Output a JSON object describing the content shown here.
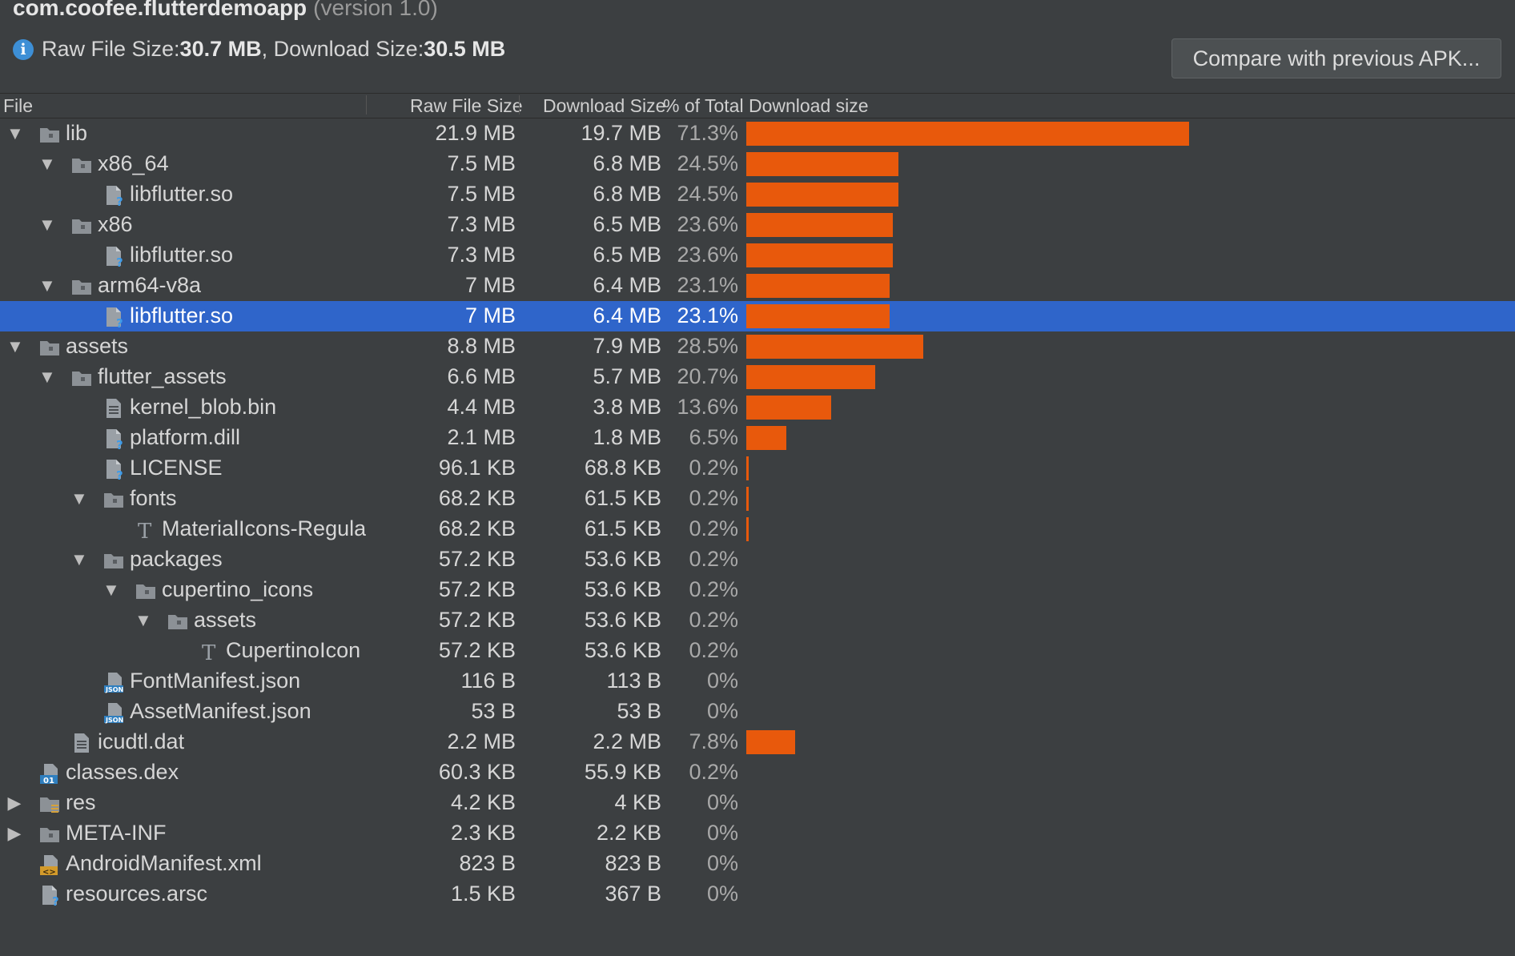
{
  "header": {
    "package": "com.coofee.flutterdemoapp",
    "version": "(version 1.0)"
  },
  "info": {
    "raw_label": "Raw File Size: ",
    "raw_value": "30.7 MB",
    "sep": ", Download Size: ",
    "dl_value": "30.5 MB"
  },
  "compare_button": "Compare with previous APK...",
  "columns": {
    "file": "File",
    "raw": "Raw File Size",
    "download": "Download Size",
    "percent": "% of Total Download size"
  },
  "accent": "#e8590c",
  "selection_color": "#2f65ca",
  "rows": [
    {
      "name": "lib",
      "raw": "21.9 MB",
      "dl": "19.7 MB",
      "pct": "71.3%",
      "level": 0,
      "kind": "folder",
      "expand": "open",
      "frac": 0.713
    },
    {
      "name": "x86_64",
      "raw": "7.5 MB",
      "dl": "6.8 MB",
      "pct": "24.5%",
      "level": 1,
      "kind": "folder",
      "expand": "open",
      "frac": 0.245
    },
    {
      "name": "libflutter.so",
      "raw": "7.5 MB",
      "dl": "6.8 MB",
      "pct": "24.5%",
      "level": 2,
      "kind": "unknown",
      "expand": "none",
      "frac": 0.245
    },
    {
      "name": "x86",
      "raw": "7.3 MB",
      "dl": "6.5 MB",
      "pct": "23.6%",
      "level": 1,
      "kind": "folder",
      "expand": "open",
      "frac": 0.236
    },
    {
      "name": "libflutter.so",
      "raw": "7.3 MB",
      "dl": "6.5 MB",
      "pct": "23.6%",
      "level": 2,
      "kind": "unknown",
      "expand": "none",
      "frac": 0.236
    },
    {
      "name": "arm64-v8a",
      "raw": "7 MB",
      "dl": "6.4 MB",
      "pct": "23.1%",
      "level": 1,
      "kind": "folder",
      "expand": "open",
      "frac": 0.231
    },
    {
      "name": "libflutter.so",
      "raw": "7 MB",
      "dl": "6.4 MB",
      "pct": "23.1%",
      "level": 2,
      "kind": "unknown",
      "expand": "none",
      "frac": 0.231,
      "selected": true
    },
    {
      "name": "assets",
      "raw": "8.8 MB",
      "dl": "7.9 MB",
      "pct": "28.5%",
      "level": 0,
      "kind": "folder",
      "expand": "open",
      "frac": 0.285
    },
    {
      "name": "flutter_assets",
      "raw": "6.6 MB",
      "dl": "5.7 MB",
      "pct": "20.7%",
      "level": 1,
      "kind": "folder",
      "expand": "open",
      "frac": 0.207
    },
    {
      "name": "kernel_blob.bin",
      "raw": "4.4 MB",
      "dl": "3.8 MB",
      "pct": "13.6%",
      "level": 2,
      "kind": "text",
      "expand": "none",
      "frac": 0.136
    },
    {
      "name": "platform.dill",
      "raw": "2.1 MB",
      "dl": "1.8 MB",
      "pct": "6.5%",
      "level": 2,
      "kind": "unknown",
      "expand": "none",
      "frac": 0.065
    },
    {
      "name": "LICENSE",
      "raw": "96.1 KB",
      "dl": "68.8 KB",
      "pct": "0.2%",
      "level": 2,
      "kind": "unknown",
      "expand": "none",
      "frac": 0.002
    },
    {
      "name": "fonts",
      "raw": "68.2 KB",
      "dl": "61.5 KB",
      "pct": "0.2%",
      "level": 2,
      "kind": "folder",
      "expand": "open",
      "frac": 0.002
    },
    {
      "name": "MaterialIcons-Regula",
      "raw": "68.2 KB",
      "dl": "61.5 KB",
      "pct": "0.2%",
      "level": 3,
      "kind": "font",
      "expand": "none",
      "frac": 0.002
    },
    {
      "name": "packages",
      "raw": "57.2 KB",
      "dl": "53.6 KB",
      "pct": "0.2%",
      "level": 2,
      "kind": "folder",
      "expand": "open",
      "frac": 0
    },
    {
      "name": "cupertino_icons",
      "raw": "57.2 KB",
      "dl": "53.6 KB",
      "pct": "0.2%",
      "level": 3,
      "kind": "folder",
      "expand": "open",
      "frac": 0
    },
    {
      "name": "assets",
      "raw": "57.2 KB",
      "dl": "53.6 KB",
      "pct": "0.2%",
      "level": 4,
      "kind": "folder",
      "expand": "open",
      "frac": 0
    },
    {
      "name": "CupertinoIcon",
      "raw": "57.2 KB",
      "dl": "53.6 KB",
      "pct": "0.2%",
      "level": 5,
      "kind": "font",
      "expand": "none",
      "frac": 0
    },
    {
      "name": "FontManifest.json",
      "raw": "116 B",
      "dl": "113 B",
      "pct": "0%",
      "level": 2,
      "kind": "json",
      "expand": "none",
      "frac": 0
    },
    {
      "name": "AssetManifest.json",
      "raw": "53 B",
      "dl": "53 B",
      "pct": "0%",
      "level": 2,
      "kind": "json",
      "expand": "none",
      "frac": 0
    },
    {
      "name": "icudtl.dat",
      "raw": "2.2 MB",
      "dl": "2.2 MB",
      "pct": "7.8%",
      "level": 1,
      "kind": "text",
      "expand": "none",
      "frac": 0.078
    },
    {
      "name": "classes.dex",
      "raw": "60.3 KB",
      "dl": "55.9 KB",
      "pct": "0.2%",
      "level": 0,
      "kind": "dex",
      "expand": "none",
      "frac": 0
    },
    {
      "name": "res",
      "raw": "4.2 KB",
      "dl": "4 KB",
      "pct": "0%",
      "level": 0,
      "kind": "resfolder",
      "expand": "closed",
      "frac": 0
    },
    {
      "name": "META-INF",
      "raw": "2.3 KB",
      "dl": "2.2 KB",
      "pct": "0%",
      "level": 0,
      "kind": "folder",
      "expand": "closed",
      "frac": 0
    },
    {
      "name": "AndroidManifest.xml",
      "raw": "823 B",
      "dl": "823 B",
      "pct": "0%",
      "level": 0,
      "kind": "xml",
      "expand": "none",
      "frac": 0
    },
    {
      "name": "resources.arsc",
      "raw": "1.5 KB",
      "dl": "367 B",
      "pct": "0%",
      "level": 0,
      "kind": "unknown",
      "expand": "none",
      "frac": 0
    }
  ]
}
